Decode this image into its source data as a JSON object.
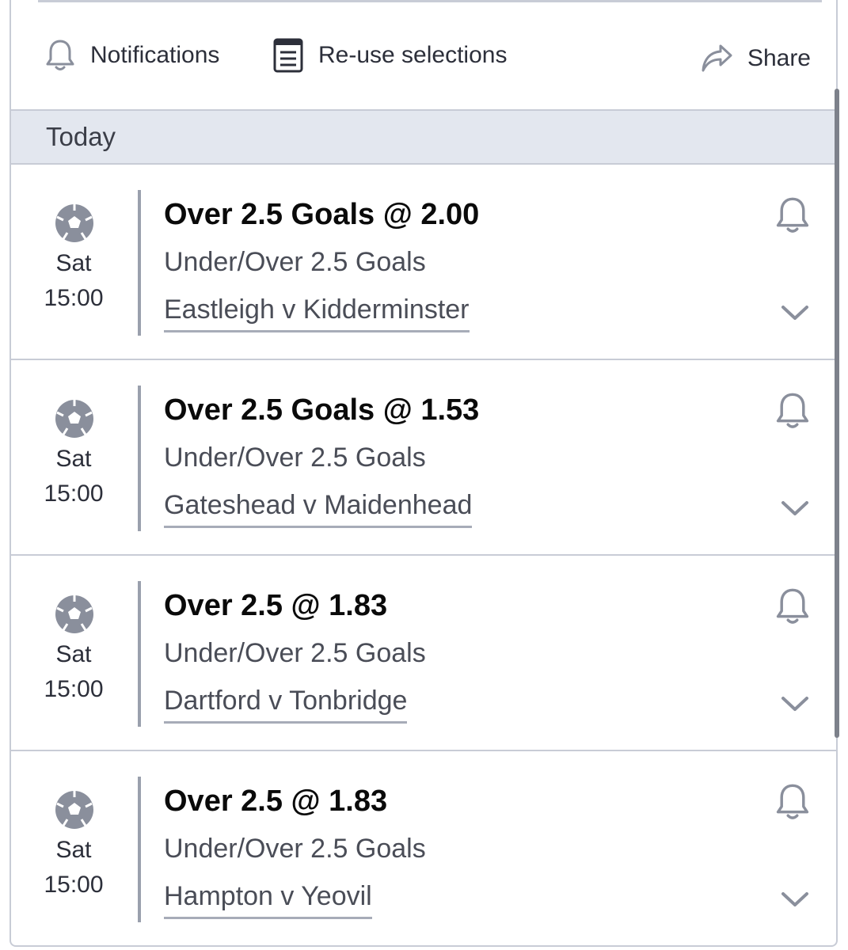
{
  "toolbar": {
    "notifications_label": "Notifications",
    "reuse_label": "Re-use selections",
    "share_label": "Share"
  },
  "section": {
    "title": "Today"
  },
  "bets": [
    {
      "selection": "Over 2.5 Goals @ 2.00",
      "market": "Under/Over 2.5 Goals",
      "event": "Eastleigh v Kidderminster",
      "day": "Sat",
      "time": "15:00"
    },
    {
      "selection": "Over 2.5 Goals @ 1.53",
      "market": "Under/Over 2.5 Goals",
      "event": "Gateshead v Maidenhead",
      "day": "Sat",
      "time": "15:00"
    },
    {
      "selection": "Over 2.5 @ 1.83",
      "market": "Under/Over 2.5 Goals",
      "event": "Dartford v Tonbridge",
      "day": "Sat",
      "time": "15:00"
    },
    {
      "selection": "Over 2.5 @ 1.83",
      "market": "Under/Over 2.5 Goals",
      "event": "Hampton v Yeovil",
      "day": "Sat",
      "time": "15:00"
    }
  ],
  "icons": {
    "notifications": "bell-icon",
    "reuse": "document-icon",
    "share": "share-arrow-icon",
    "sport": "football-icon",
    "alert": "bell-icon",
    "expand": "chevron-down-icon"
  },
  "colors": {
    "border": "#c8ccd6",
    "section_bg": "#e3e7ef",
    "icon_gray": "#8a8f9c"
  }
}
